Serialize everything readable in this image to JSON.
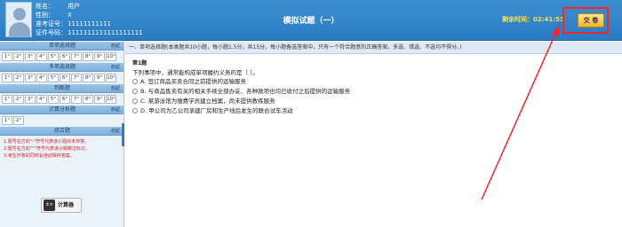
{
  "header": {
    "name_label": "姓名：",
    "name_value": "用户",
    "gender_label": "性别：",
    "gender_value": "X",
    "ticket_label": "准考证号：",
    "ticket_value": "11111111111",
    "id_label": "证件号码：",
    "id_value": "1111111111111111111",
    "exam_title": "模拟试题（一）",
    "timer_label": "剩余时间：",
    "timer_value": "02:41:53",
    "submit_label": "交 卷"
  },
  "sidebar": {
    "sections": [
      {
        "title": "单项选择题",
        "collapse": "收起",
        "buttons": [
          "1°",
          "2°",
          "3°",
          "4°",
          "5°",
          "6°",
          "7°",
          "8°",
          "9°",
          "10°"
        ]
      },
      {
        "title": "多项选择题",
        "collapse": "收起",
        "buttons": [
          "1°",
          "2°",
          "3°",
          "4°",
          "5°",
          "6°",
          "7°",
          "8°",
          "9°",
          "10°"
        ]
      },
      {
        "title": "判断题",
        "collapse": "收起",
        "buttons": [
          "1°",
          "2°",
          "3°",
          "4°",
          "5°",
          "6°",
          "7°",
          "8°",
          "9°",
          "10°"
        ]
      },
      {
        "title": "计算分析题",
        "collapse": "收起",
        "buttons": [
          "1°",
          "2°"
        ]
      },
      {
        "title": "综合题",
        "collapse": "收起",
        "buttons": []
      }
    ],
    "legend": [
      "1.题号右方的\"-\"符号代表该小题尚未作答。",
      "2.题号右方的\"°\"符号代表该小题做过标记。",
      "3.考生作答的同时会自动保存答案。"
    ],
    "calculator_label": "计算器",
    "calculator_icon": "calculator-icon"
  },
  "main": {
    "section_banner": "一、单项选择题(本类题共10小题，每小题1.5分，共15分。每小题备选答案中，只有一个符合题意的正确答案。多选、错选、不选均不得分。)",
    "question_number": "第1题",
    "question_stem": "下列事项中，通常能构成单项履约义务的是（    ）。",
    "options": [
      "A. 签订商品买卖合同之前提供的运输服务",
      "B. 与商品售卖有关的相关手续全部办妥、各种款项也均已收付之后提供的运输服务",
      "C. 某游泳馆为缴费学员建立档案，尚未提供教练服务",
      "D. 甲公司为乙公司承建厂房和生产线后发生的联合试车活动"
    ]
  },
  "colors": {
    "header_blue": "#2a7cc3",
    "timer_yellow": "#ffe14d",
    "annotation_red": "#ff2222",
    "legend_red": "#e02020"
  }
}
